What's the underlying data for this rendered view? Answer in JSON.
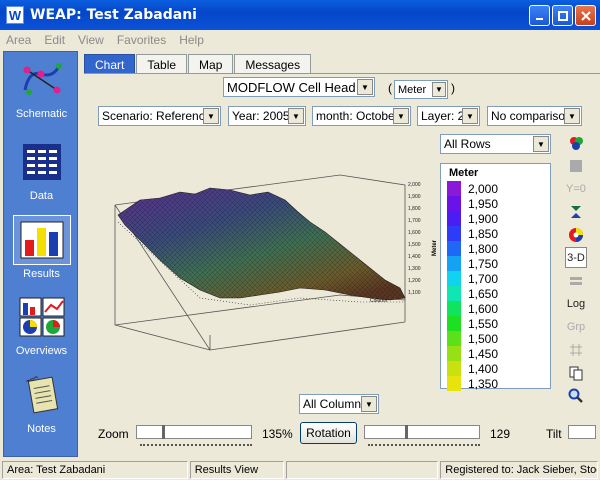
{
  "window": {
    "title": "WEAP: Test Zabadani",
    "app_icon_letter": "W"
  },
  "menu": [
    "Area",
    "Edit",
    "View",
    "Favorites",
    "Help"
  ],
  "sidebar": [
    {
      "label": "Schematic",
      "icon": "schematic-icon"
    },
    {
      "label": "Data",
      "icon": "data-icon"
    },
    {
      "label": "Results",
      "icon": "results-icon",
      "selected": true
    },
    {
      "label": "Overviews",
      "icon": "overviews-icon"
    },
    {
      "label": "Notes",
      "icon": "notes-icon"
    }
  ],
  "tabs": [
    {
      "label": "Chart",
      "active": true
    },
    {
      "label": "Table"
    },
    {
      "label": "Map"
    },
    {
      "label": "Messages"
    }
  ],
  "variable": "MODFLOW Cell Head",
  "unit": "Meter",
  "filters": {
    "scenario": "Scenario: Reference",
    "year": "Year: 2005",
    "month": "month: October",
    "layer": "Layer: 2",
    "comparison": "No comparison"
  },
  "rows_select": "All Rows",
  "columns_select": "All Columns",
  "right_tools": [
    "palette-icon",
    "square-icon",
    "Y=0",
    "sort-icon",
    "color-wheel-icon",
    "3-D",
    "bars-icon",
    "Log",
    "Grp",
    "grid-icon",
    "copy-icon",
    "zoom-icon"
  ],
  "chart_data": {
    "type": "heatmap",
    "title": "",
    "legend_title": "Meter",
    "legend": [
      {
        "value": "2,000",
        "color": "#8b19d8"
      },
      {
        "value": "1,950",
        "color": "#6a13e8"
      },
      {
        "value": "1,900",
        "color": "#4b1cf4"
      },
      {
        "value": "1,850",
        "color": "#2d3cf8"
      },
      {
        "value": "1,800",
        "color": "#1f68f6"
      },
      {
        "value": "1,750",
        "color": "#14a2f3"
      },
      {
        "value": "1,700",
        "color": "#10d4ef"
      },
      {
        "value": "1,650",
        "color": "#0fe6b2"
      },
      {
        "value": "1,600",
        "color": "#10e45f"
      },
      {
        "value": "1,550",
        "color": "#1ee023"
      },
      {
        "value": "1,500",
        "color": "#5ce01a"
      },
      {
        "value": "1,450",
        "color": "#97e014"
      },
      {
        "value": "1,400",
        "color": "#c7e20f"
      },
      {
        "value": "1,350",
        "color": "#e6e40c"
      }
    ],
    "zaxis_ticks": [
      "2,000",
      "1,900",
      "1,800",
      "1,700",
      "1,600",
      "1,500",
      "1,400",
      "1,300",
      "1,200",
      "1,100"
    ],
    "zaxis_label": "Meter",
    "xaxis_label": "Column"
  },
  "controls": {
    "zoom_label": "Zoom",
    "zoom_value": "135%",
    "zoom_level": 0.22,
    "rotation_label": "Rotation",
    "rotation_value": "129",
    "rotation_level": 0.36,
    "tilt_label": "Tilt"
  },
  "status": {
    "area": "Area: Test Zabadani",
    "view": "Results View",
    "blank": "",
    "registered": "Registered to: Jack Sieber, Stoc"
  },
  "colors": {
    "titlebar": "#0646c8",
    "sidebar": "#4f7fd0",
    "active_tab": "#3366cc"
  }
}
